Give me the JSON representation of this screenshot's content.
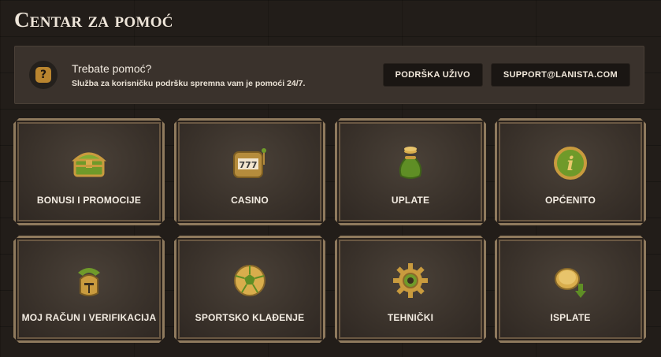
{
  "page": {
    "title": "Centar za pomoć"
  },
  "help": {
    "icon": "question-icon",
    "question_mark": "?",
    "title": "Trebate pomoć?",
    "subtitle": "Služba za korisničku podršku spremna vam je pomoći 24/7.",
    "live_button": "PODRŠKA UŽIVO",
    "email_button": "SUPPORT@LANISTA.COM"
  },
  "categories": [
    {
      "label": "BONUSI I PROMOCIJE",
      "icon": "treasure-chest-icon"
    },
    {
      "label": "CASINO",
      "icon": "slot-machine-icon"
    },
    {
      "label": "UPLATE",
      "icon": "money-bag-icon"
    },
    {
      "label": "OPĆENITO",
      "icon": "info-icon"
    },
    {
      "label": "MOJ RAČUN I VERIFIKACIJA",
      "icon": "gladiator-helmet-icon"
    },
    {
      "label": "SPORTSKO KLAĐENJE",
      "icon": "football-icon"
    },
    {
      "label": "TEHNIČKI",
      "icon": "gear-icon"
    },
    {
      "label": "ISPLATE",
      "icon": "coin-withdraw-icon"
    }
  ],
  "colors": {
    "gold": "#c99b3e",
    "green": "#6f9a2a",
    "background": "#221d19"
  }
}
